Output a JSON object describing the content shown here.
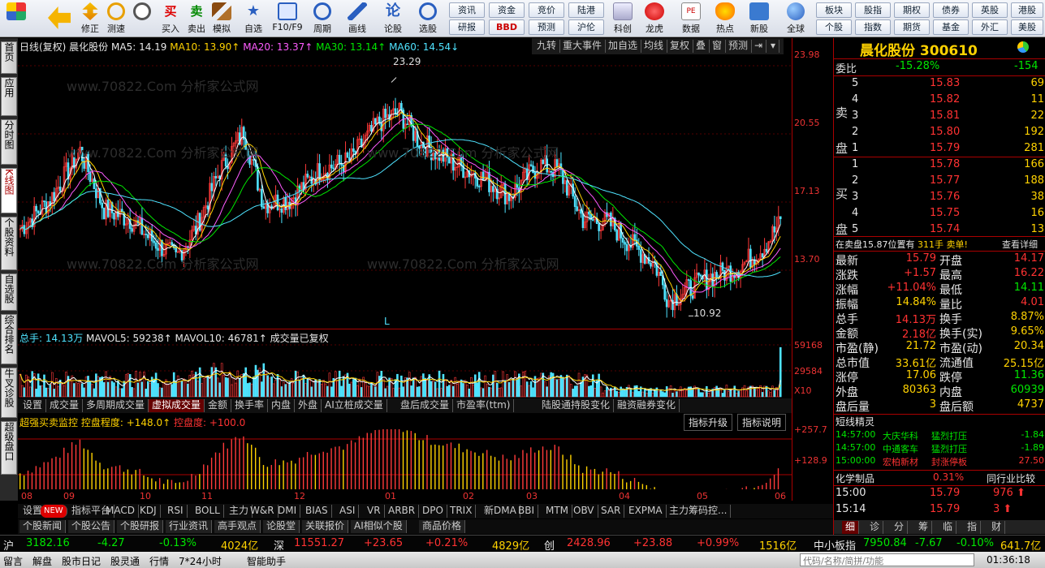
{
  "toolbar": {
    "main": [
      {
        "id": "home",
        "label": ""
      },
      {
        "id": "back",
        "label": ""
      },
      {
        "id": "fix",
        "label": "修正"
      },
      {
        "id": "test",
        "label": "测速"
      },
      {
        "id": "buy",
        "label": "买入"
      },
      {
        "id": "sell",
        "label": "卖出"
      },
      {
        "id": "sim",
        "label": "模拟"
      },
      {
        "id": "fav",
        "label": "自选"
      },
      {
        "id": "f10",
        "label": "F10/F9"
      },
      {
        "id": "period",
        "label": "周期"
      },
      {
        "id": "draw",
        "label": "画线"
      },
      {
        "id": "lungu",
        "label": "论股"
      },
      {
        "id": "select",
        "label": "选股"
      }
    ],
    "links_top": [
      "资讯",
      "资金",
      "竞价",
      "陆港"
    ],
    "links_bot": [
      "研报",
      "BBD",
      "预测",
      "沪伦"
    ],
    "apps": [
      "科创",
      "龙虎",
      "数据",
      "热点",
      "新股"
    ],
    "global": "全球",
    "market_top": [
      "板块",
      "股指",
      "期权",
      "债券",
      "英股",
      "港股"
    ],
    "market_bot": [
      "个股",
      "指数",
      "期货",
      "基金",
      "外汇",
      "美股"
    ]
  },
  "leftnav": [
    "首页",
    "应用",
    "分时图",
    "K线图",
    "个股资料",
    "自选股",
    "综合排名",
    "牛叉诊股",
    "超级盘口"
  ],
  "chart": {
    "header": {
      "name": "日线(复权) 晨化股份",
      "ma5": "MA5: 14.19",
      "ma10": "MA10: 13.90↑",
      "ma20": "MA20: 13.37↑",
      "ma30": "MA30: 13.14↑",
      "ma60": "MA60: 14.54↓"
    },
    "header_tools": [
      "九转",
      "重大事件",
      "加自选",
      "均线",
      "复权",
      "叠",
      "窗",
      "预测"
    ],
    "price_axis": [
      "23.98",
      "20.55",
      "17.13",
      "13.70"
    ],
    "high_label": "23.29",
    "low_label": "10.92",
    "l_mark": "L",
    "watermark": "www.70822.Com 分析家公式网",
    "vol_header": {
      "total": "总手: 14.13万",
      "mavol5": "MAVOL5: 59238↑",
      "mavol10": "MAVOL10: 46781↑",
      "note": "成交量已复权"
    },
    "vol_axis": [
      "59168",
      "29584",
      "X10"
    ],
    "vol_tabs": [
      "设置",
      "成交量",
      "多周期成交量",
      "虚拟成交量",
      "金额",
      "换手率",
      "内盘",
      "外盘",
      "AI立桩成交量",
      "盘后成交量",
      "市盈率(ttm)",
      "陆股通持股变化",
      "融资融券变化"
    ],
    "ind_header": {
      "name": "超强买卖监控",
      "p1": "控盘程度: +148.0↑",
      "p2": "控盘度: +100.0"
    },
    "ind_buttons": [
      "指标升级",
      "指标说明"
    ],
    "ind_axis": [
      "+257.7",
      "+128.9"
    ],
    "months": [
      "08",
      "09",
      "10",
      "11",
      "12",
      "01",
      "02",
      "03",
      "04",
      "05",
      "06"
    ],
    "ind_tabs": [
      "设置",
      "NEW",
      "指标平台",
      "MACD",
      "KDJ",
      "RSI",
      "BOLL",
      "主力",
      "W&R",
      "DMI",
      "BIAS",
      "ASI",
      "VR",
      "ARBR",
      "DPO",
      "TRIX",
      "新DMA",
      "BBI",
      "MTM",
      "OBV",
      "SAR",
      "EXPMA",
      "主力筹码控..."
    ],
    "sub_tabs": [
      "个股新闻",
      "个股公告",
      "个股研报",
      "行业资讯",
      "高手观点",
      "论股堂",
      "关联报价",
      "AI相似个股",
      "商品价格"
    ]
  },
  "chart_data": {
    "type": "candlestick",
    "title": "日线(复权) 晨化股份",
    "price_ylim": [
      10.92,
      23.98
    ],
    "high": 23.29,
    "low": 10.92,
    "ma": {
      "MA5": 14.19,
      "MA10": 13.9,
      "MA20": 13.37,
      "MA30": 13.14,
      "MA60": 14.54
    },
    "vol_ylim": [
      0,
      59168
    ],
    "months": [
      "08",
      "09",
      "10",
      "11",
      "12",
      "01",
      "02",
      "03",
      "04",
      "05",
      "06"
    ]
  },
  "quote": {
    "title": "晨化股份 300610",
    "weibi": {
      "label": "委比",
      "value": "-15.28%",
      "extra": "-154"
    },
    "sell": [
      {
        "n": "5",
        "p": "15.83",
        "v": "69"
      },
      {
        "n": "4",
        "p": "15.82",
        "v": "11"
      },
      {
        "n": "3",
        "p": "15.81",
        "v": "22"
      },
      {
        "n": "2",
        "p": "15.80",
        "v": "192"
      },
      {
        "n": "1",
        "p": "15.79",
        "v": "281"
      }
    ],
    "buy": [
      {
        "n": "1",
        "p": "15.78",
        "v": "166"
      },
      {
        "n": "2",
        "p": "15.77",
        "v": "188"
      },
      {
        "n": "3",
        "p": "15.76",
        "v": "38"
      },
      {
        "n": "4",
        "p": "15.75",
        "v": "16"
      },
      {
        "n": "5",
        "p": "15.74",
        "v": "13"
      }
    ],
    "sell_label": [
      "卖",
      "盘"
    ],
    "buy_label": [
      "买",
      "盘"
    ],
    "info": "在卖盘15.87位置有",
    "info_v": "311手",
    "info_t": "卖单!",
    "info_btn": "查看详细",
    "stats": [
      [
        "最新",
        "15.79",
        "开盘",
        "14.17"
      ],
      [
        "涨跌",
        "+1.57",
        "最高",
        "16.22"
      ],
      [
        "涨幅",
        "+11.04%",
        "最低",
        "14.11"
      ],
      [
        "振幅",
        "14.84%",
        "量比",
        "4.01"
      ],
      [
        "总手",
        "14.13万",
        "换手",
        "8.87%"
      ],
      [
        "金额",
        "2.18亿",
        "换手(实)",
        "9.65%"
      ],
      [
        "市盈(静)",
        "21.72",
        "市盈(动)",
        "20.34"
      ],
      [
        "总市值",
        "33.61亿",
        "流通值",
        "25.15亿"
      ],
      [
        "涨停",
        "17.06",
        "跌停",
        "11.36"
      ],
      [
        "外盘",
        "80363",
        "内盘",
        "60939"
      ],
      [
        "盘后量",
        "3",
        "盘后额",
        "4737"
      ]
    ],
    "short_title": "短线精灵",
    "short": [
      [
        "14:57:00",
        "大庆华科",
        "猛烈打压",
        "-1.84"
      ],
      [
        "14:57:00",
        "中通客车",
        "猛烈打压",
        "-1.89"
      ],
      [
        "15:00:00",
        "宏柏新材",
        "封涨停板",
        "27.50"
      ]
    ],
    "industry": "化学制品",
    "industry_pct": "0.31%",
    "industry_btn": "同行业比较",
    "ticks": [
      [
        "15:00",
        "15.79",
        "976"
      ],
      [
        "15:14",
        "15.79",
        "3"
      ]
    ],
    "bottom_tabs": [
      "细",
      "诊",
      "分",
      "筹",
      "临",
      "指",
      "财"
    ]
  },
  "bottom": {
    "sh": {
      "name": "沪",
      "v": "3182.16",
      "c": "-4.27",
      "p": "-0.13%",
      "a": "4024亿"
    },
    "sz": {
      "name": "深",
      "v": "11551.27",
      "c": "+23.65",
      "p": "+0.21%",
      "a": "4829亿"
    },
    "cy": {
      "name": "创",
      "v": "2428.96",
      "c": "+23.88",
      "p": "+0.99%",
      "a": "1516亿"
    },
    "zx": {
      "name": "中小板指",
      "v": "7950.84",
      "c": "-7.67",
      "p": "-0.10%",
      "a": "641.7亿"
    },
    "status": [
      "留言",
      "解盘",
      "股市日记",
      "股灵通",
      "行情",
      "7*24小时",
      "智能助手"
    ],
    "search": "代码/名称/简拼/功能",
    "time": "01:36:18"
  }
}
